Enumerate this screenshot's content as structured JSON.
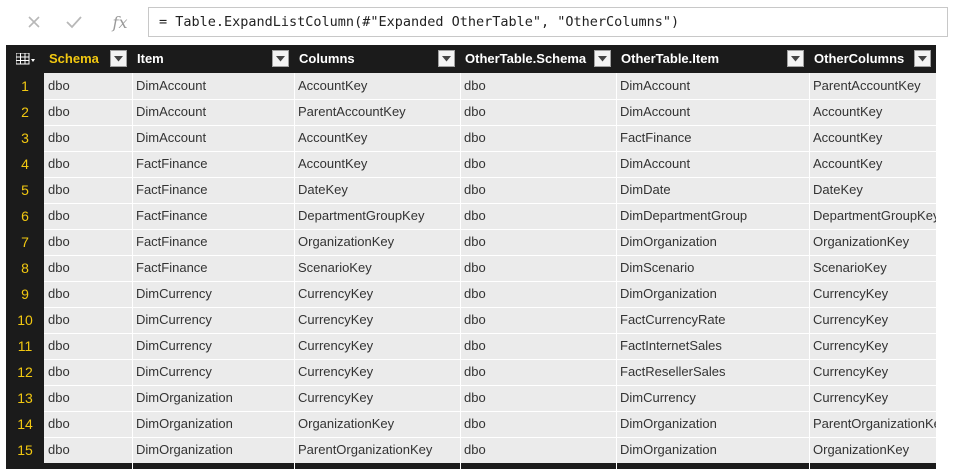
{
  "formula_bar": {
    "cancel_icon": "x-icon",
    "confirm_icon": "check-icon",
    "fx_label": "fx",
    "formula": "= Table.ExpandListColumn(#\"Expanded OtherTable\", \"OtherColumns\")"
  },
  "table": {
    "columns": [
      {
        "name": "Schema",
        "active": true
      },
      {
        "name": "Item"
      },
      {
        "name": "Columns"
      },
      {
        "name": "OtherTable.Schema"
      },
      {
        "name": "OtherTable.Item"
      },
      {
        "name": "OtherColumns"
      }
    ],
    "rows": [
      {
        "num": "1",
        "cells": [
          "dbo",
          "DimAccount",
          "AccountKey",
          "dbo",
          "DimAccount",
          "ParentAccountKey"
        ]
      },
      {
        "num": "2",
        "cells": [
          "dbo",
          "DimAccount",
          "ParentAccountKey",
          "dbo",
          "DimAccount",
          "AccountKey"
        ]
      },
      {
        "num": "3",
        "cells": [
          "dbo",
          "DimAccount",
          "AccountKey",
          "dbo",
          "FactFinance",
          "AccountKey"
        ]
      },
      {
        "num": "4",
        "cells": [
          "dbo",
          "FactFinance",
          "AccountKey",
          "dbo",
          "DimAccount",
          "AccountKey"
        ]
      },
      {
        "num": "5",
        "cells": [
          "dbo",
          "FactFinance",
          "DateKey",
          "dbo",
          "DimDate",
          "DateKey"
        ]
      },
      {
        "num": "6",
        "cells": [
          "dbo",
          "FactFinance",
          "DepartmentGroupKey",
          "dbo",
          "DimDepartmentGroup",
          "DepartmentGroupKey"
        ]
      },
      {
        "num": "7",
        "cells": [
          "dbo",
          "FactFinance",
          "OrganizationKey",
          "dbo",
          "DimOrganization",
          "OrganizationKey"
        ]
      },
      {
        "num": "8",
        "cells": [
          "dbo",
          "FactFinance",
          "ScenarioKey",
          "dbo",
          "DimScenario",
          "ScenarioKey"
        ]
      },
      {
        "num": "9",
        "cells": [
          "dbo",
          "DimCurrency",
          "CurrencyKey",
          "dbo",
          "DimOrganization",
          "CurrencyKey"
        ]
      },
      {
        "num": "10",
        "cells": [
          "dbo",
          "DimCurrency",
          "CurrencyKey",
          "dbo",
          "FactCurrencyRate",
          "CurrencyKey"
        ]
      },
      {
        "num": "11",
        "cells": [
          "dbo",
          "DimCurrency",
          "CurrencyKey",
          "dbo",
          "FactInternetSales",
          "CurrencyKey"
        ]
      },
      {
        "num": "12",
        "cells": [
          "dbo",
          "DimCurrency",
          "CurrencyKey",
          "dbo",
          "FactResellerSales",
          "CurrencyKey"
        ]
      },
      {
        "num": "13",
        "cells": [
          "dbo",
          "DimOrganization",
          "CurrencyKey",
          "dbo",
          "DimCurrency",
          "CurrencyKey"
        ]
      },
      {
        "num": "14",
        "cells": [
          "dbo",
          "DimOrganization",
          "OrganizationKey",
          "dbo",
          "DimOrganization",
          "ParentOrganizationKey"
        ]
      },
      {
        "num": "15",
        "cells": [
          "dbo",
          "DimOrganization",
          "ParentOrganizationKey",
          "dbo",
          "DimOrganization",
          "OrganizationKey"
        ]
      }
    ]
  },
  "colors": {
    "header_bg": "#1b1b1b",
    "active_header": "#f2c811",
    "row_number": "#f2c811",
    "cell_bg": "#ebebeb"
  }
}
